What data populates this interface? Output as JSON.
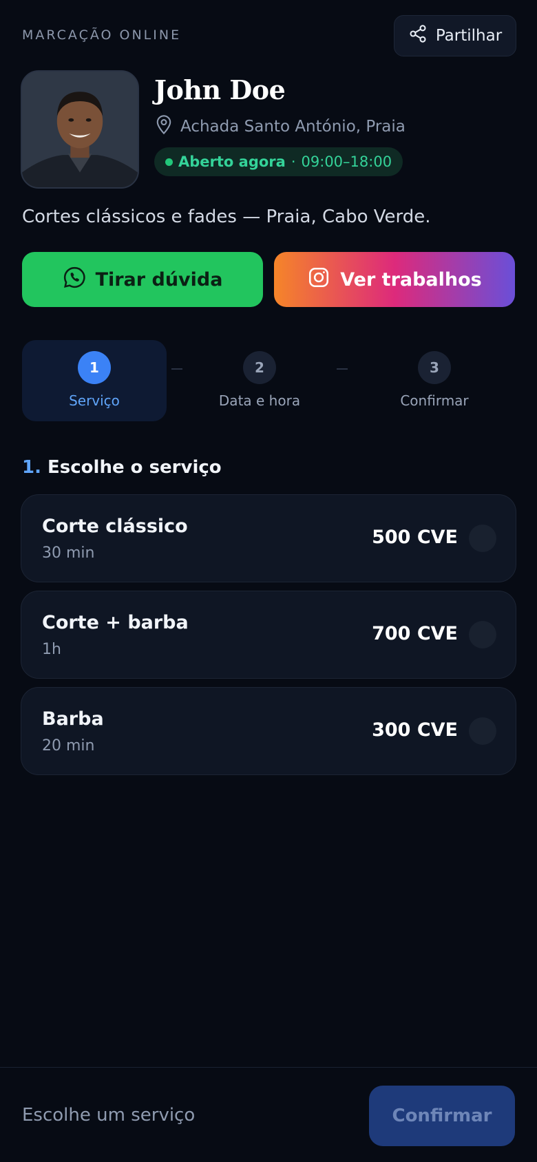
{
  "header": {
    "kicker": "MARCAÇÃO ONLINE",
    "share_label": "Partilhar"
  },
  "profile": {
    "name": "John Doe",
    "location": "Achada Santo António, Praia",
    "status_open": "Aberto agora",
    "status_separator": "·",
    "status_hours": "09:00–18:00",
    "tagline": "Cortes clássicos e fades — Praia, Cabo Verde."
  },
  "actions": {
    "whatsapp_label": "Tirar dúvida",
    "instagram_label": "Ver trabalhos"
  },
  "steps": [
    {
      "num": "1",
      "label": "Serviço",
      "active": true
    },
    {
      "num": "2",
      "label": "Data e hora",
      "active": false
    },
    {
      "num": "3",
      "label": "Confirmar",
      "active": false
    }
  ],
  "services_section": {
    "number": "1.",
    "title": "Escolhe o serviço"
  },
  "services": [
    {
      "name": "Corte clássico",
      "duration": "30 min",
      "price": "500 CVE"
    },
    {
      "name": "Corte + barba",
      "duration": "1h",
      "price": "700 CVE"
    },
    {
      "name": "Barba",
      "duration": "20 min",
      "price": "300 CVE"
    }
  ],
  "footer": {
    "hint": "Escolhe um serviço",
    "confirm_label": "Confirmar"
  },
  "colors": {
    "background": "#070b14",
    "accent": "#3b82f6",
    "whatsapp": "#22c55e",
    "open_status": "#34d399"
  }
}
